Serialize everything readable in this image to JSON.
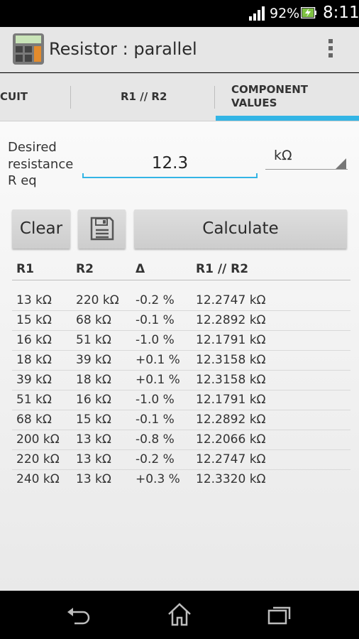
{
  "status_bar": {
    "battery_percent": "92%",
    "time": "8:11"
  },
  "action_bar": {
    "title": "Resistor : parallel",
    "app_icon_label": "R,L,C"
  },
  "tabs": [
    {
      "label": "CIRCUIT",
      "visible_text": "CUIT"
    },
    {
      "label": "R1 // R2"
    },
    {
      "label_line1": "COMPONENT",
      "label_line2": "VALUES",
      "selected": true
    }
  ],
  "form": {
    "desired_label": "Desired resistance R eq",
    "desired_value": "12.3",
    "unit": "kΩ"
  },
  "buttons": {
    "clear": "Clear",
    "calculate": "Calculate"
  },
  "table": {
    "headers": [
      "R1",
      "R2",
      "Δ",
      "R1 // R2"
    ],
    "rows": [
      [
        "13 kΩ",
        "220 kΩ",
        "-0.2 %",
        "12.2747 kΩ"
      ],
      [
        "15 kΩ",
        "68 kΩ",
        "-0.1 %",
        "12.2892 kΩ"
      ],
      [
        "16 kΩ",
        "51 kΩ",
        "-1.0 %",
        "12.1791 kΩ"
      ],
      [
        "18 kΩ",
        "39 kΩ",
        "+0.1 %",
        "12.3158 kΩ"
      ],
      [
        "39 kΩ",
        "18 kΩ",
        "+0.1 %",
        "12.3158 kΩ"
      ],
      [
        "51 kΩ",
        "16 kΩ",
        "-1.0 %",
        "12.1791 kΩ"
      ],
      [
        "68 kΩ",
        "15 kΩ",
        "-0.1 %",
        "12.2892 kΩ"
      ],
      [
        "200 kΩ",
        "13 kΩ",
        "-0.8 %",
        "12.2066 kΩ"
      ],
      [
        "220 kΩ",
        "13 kΩ",
        "-0.2 %",
        "12.2747 kΩ"
      ],
      [
        "240 kΩ",
        "13 kΩ",
        "+0.3 %",
        "12.3320 kΩ"
      ]
    ]
  },
  "colors": {
    "accent": "#33b5e5"
  }
}
